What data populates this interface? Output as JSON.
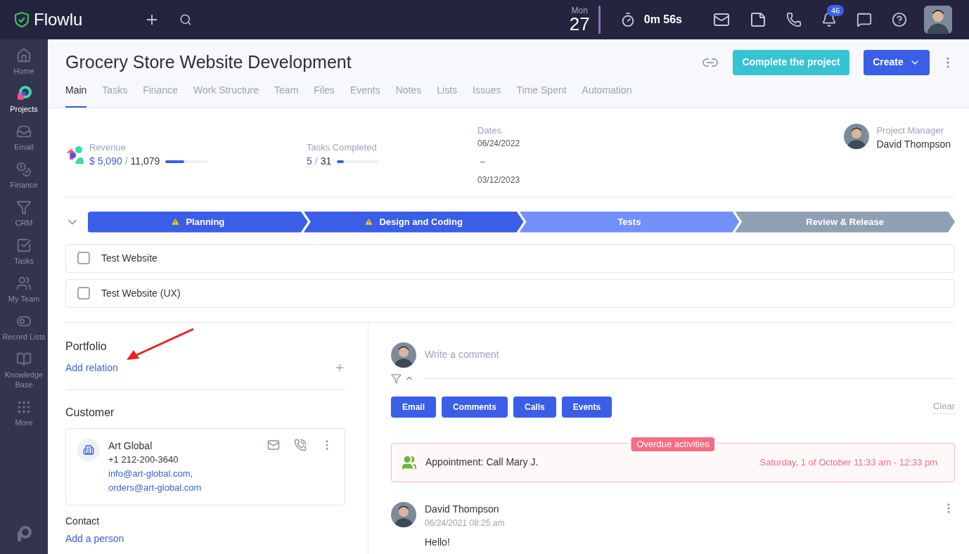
{
  "topbar": {
    "logo": "Flowlu",
    "weekday": "Mon",
    "day": "27",
    "timer": "0m 56s",
    "notifications": "46"
  },
  "sidebar": {
    "items": [
      {
        "label": "Home",
        "selected": false
      },
      {
        "label": "Projects",
        "selected": true
      },
      {
        "label": "Email",
        "selected": false
      },
      {
        "label": "Finance",
        "selected": false
      },
      {
        "label": "CRM",
        "selected": false
      },
      {
        "label": "Tasks",
        "selected": false
      },
      {
        "label": "My Team",
        "selected": false
      },
      {
        "label": "Record Lists",
        "selected": false
      },
      {
        "label": "Knowledge Base",
        "selected": false
      },
      {
        "label": "More",
        "selected": false
      }
    ]
  },
  "project": {
    "title": "Grocery Store Website Development",
    "complete_button": "Complete the project",
    "create_button": "Create",
    "tabs": [
      {
        "label": "Main",
        "selected": true
      },
      {
        "label": "Tasks",
        "selected": false
      },
      {
        "label": "Finance",
        "selected": false
      },
      {
        "label": "Work Structure",
        "selected": false
      },
      {
        "label": "Team",
        "selected": false
      },
      {
        "label": "Files",
        "selected": false
      },
      {
        "label": "Events",
        "selected": false
      },
      {
        "label": "Notes",
        "selected": false
      },
      {
        "label": "Lists",
        "selected": false
      },
      {
        "label": "Issues",
        "selected": false
      },
      {
        "label": "Time Spent",
        "selected": false
      },
      {
        "label": "Automation",
        "selected": false
      }
    ]
  },
  "stats": {
    "revenue": {
      "label": "Revenue",
      "amount": "$ 5,090",
      "separator": "/",
      "total": "11,079",
      "level": 0.45
    },
    "tasks": {
      "label": "Tasks Completed",
      "done": "5",
      "separator": "/",
      "total": "31",
      "level": 0.16
    },
    "dates": {
      "label": "Dates",
      "start": "06/24/2022",
      "separator": "–",
      "end": "03/12/2023"
    },
    "manager": {
      "label": "Project Manager",
      "name": "David Thompson"
    }
  },
  "stages": [
    {
      "label": "Planning",
      "kind": "done",
      "warning": true
    },
    {
      "label": "Design and Coding",
      "kind": "done",
      "warning": true
    },
    {
      "label": "Tests",
      "kind": "current",
      "warning": false
    },
    {
      "label": "Review & Release",
      "kind": "future",
      "warning": false
    }
  ],
  "checklist": [
    {
      "label": "Test Website",
      "checked": false
    },
    {
      "label": "Test Website (UX)",
      "checked": false
    }
  ],
  "portfolio": {
    "title": "Portfolio",
    "link": "Add relation"
  },
  "customer": {
    "title": "Customer",
    "name": "Art Global",
    "phone": "+1 212-200-3640",
    "emails": [
      "info@art-global.com,",
      "orders@art-global.com"
    ]
  },
  "contact": {
    "title": "Contact",
    "link": "Add a person"
  },
  "activity": {
    "placeholder": "Write a comment",
    "clear": "Clear",
    "filters": [
      {
        "label": "Email",
        "selected": true
      },
      {
        "label": "Comments",
        "selected": true
      },
      {
        "label": "Calls",
        "selected": true
      },
      {
        "label": "Events",
        "selected": true
      }
    ],
    "overdue": {
      "badge": "Overdue activities",
      "title": "Appointment: Call Mary J.",
      "time": "Saturday, 1 of October 11:33 am - 12:33 pm"
    },
    "posts": [
      {
        "author": "David Thompson",
        "time": "06/24/2021 08:25 am",
        "text": "Hello!"
      }
    ]
  }
}
